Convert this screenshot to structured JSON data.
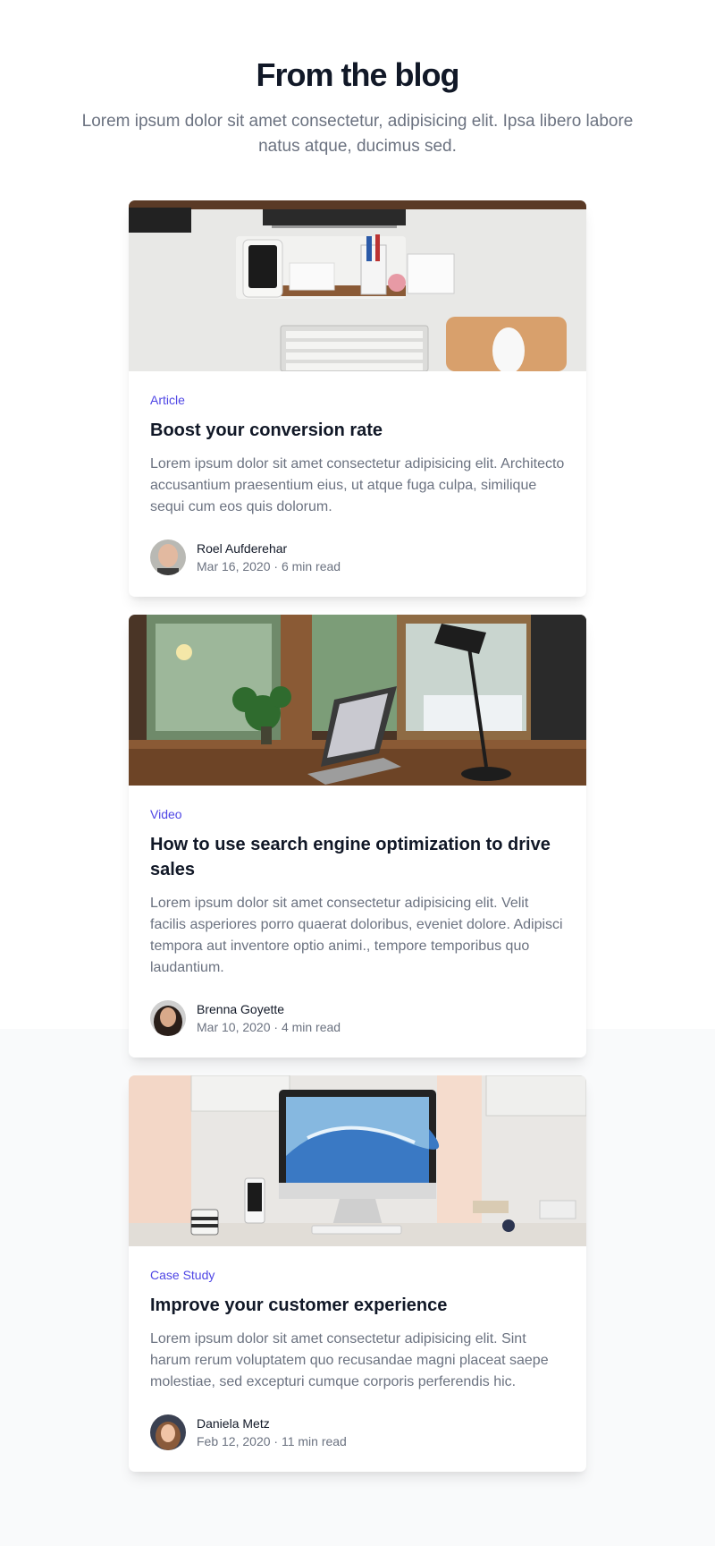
{
  "header": {
    "title": "From the blog",
    "subtitle": "Lorem ipsum dolor sit amet consectetur, adipisicing elit. Ipsa libero labore natus atque, ducimus sed."
  },
  "colors": {
    "accent": "#4f46e5",
    "heading": "#111827",
    "muted": "#6b7280",
    "band": "#f9fafb"
  },
  "posts": [
    {
      "category": "Article",
      "title": "Boost your conversion rate",
      "excerpt": "Lorem ipsum dolor sit amet consectetur adipisicing elit. Architecto accusantium praesentium eius, ut atque fuga culpa, similique sequi cum eos quis dolorum.",
      "author": "Roel Aufderehar",
      "date": "Mar 16, 2020",
      "read_time": "6 min read",
      "meta": "Mar 16, 2020 · 6 min read"
    },
    {
      "category": "Video",
      "title": "How to use search engine optimization to drive sales",
      "excerpt": "Lorem ipsum dolor sit amet consectetur adipisicing elit. Velit facilis asperiores porro quaerat doloribus, eveniet dolore. Adipisci tempora aut inventore optio animi., tempore temporibus quo laudantium.",
      "author": "Brenna Goyette",
      "date": "Mar 10, 2020",
      "read_time": "4 min read",
      "meta": "Mar 10, 2020 · 4 min read"
    },
    {
      "category": "Case Study",
      "title": "Improve your customer experience",
      "excerpt": "Lorem ipsum dolor sit amet consectetur adipisicing elit. Sint harum rerum voluptatem quo recusandae magni placeat saepe molestiae, sed excepturi cumque corporis perferendis hic.",
      "author": "Daniela Metz",
      "date": "Feb 12, 2020",
      "read_time": "11 min read",
      "meta": "Feb 12, 2020 · 11 min read"
    }
  ]
}
